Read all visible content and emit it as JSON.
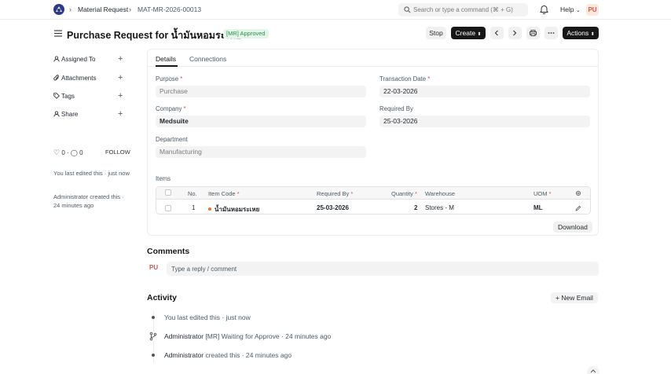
{
  "navbar": {
    "breadcrumbs": [
      "Material Request",
      "MAT-MR-2026-00013"
    ],
    "search_placeholder": "Search or type a command (⌘ + G)",
    "help_label": "Help",
    "user_initials": "PU"
  },
  "page": {
    "title": "Purchase Request for น้ำมันหอมระเหย",
    "status": "[MR] Approved",
    "buttons": {
      "stop": "Stop",
      "create": "Create",
      "actions": "Actions"
    }
  },
  "sidebar": {
    "items": [
      {
        "label": "Assigned To",
        "icon": "user-icon"
      },
      {
        "label": "Attachments",
        "icon": "paperclip-icon"
      },
      {
        "label": "Tags",
        "icon": "tag-icon"
      },
      {
        "label": "Share",
        "icon": "share-icon"
      }
    ],
    "likes": "0",
    "comments": "0",
    "follow_label": "FOLLOW",
    "last_edited": "You last edited this · just now",
    "created": "Administrator created this · 24 minutes ago"
  },
  "tabs": [
    "Details",
    "Connections"
  ],
  "form": {
    "purpose": {
      "label": "Purpose",
      "value": "Purchase"
    },
    "transaction_date": {
      "label": "Transaction Date",
      "value": "22-03-2026"
    },
    "company": {
      "label": "Company",
      "value": "Medsuite"
    },
    "required_by": {
      "label": "Required By",
      "value": "25-03-2026"
    },
    "department": {
      "label": "Department",
      "placeholder": "Manufacturing"
    }
  },
  "items": {
    "label": "Items",
    "columns": [
      "No.",
      "Item Code",
      "Required By",
      "Quantity",
      "Warehouse",
      "UOM"
    ],
    "rows": [
      {
        "no": "1",
        "item_code": "น้ำมันหอมระเหย",
        "required_by": "25-03-2026",
        "quantity": "2",
        "warehouse": "Stores - M",
        "uom": "ML"
      }
    ],
    "download_label": "Download"
  },
  "comments": {
    "title": "Comments",
    "avatar": "PU",
    "placeholder": "Type a reply / comment"
  },
  "activity": {
    "title": "Activity",
    "new_email_label": "+ New Email",
    "entries": [
      {
        "actor": "",
        "text": "You last edited this · just now"
      },
      {
        "actor": "Administrator",
        "text": " [MR] Waiting for Approve · 24 minutes ago"
      },
      {
        "actor": "Administrator",
        "text": " created this · 24 minutes ago"
      }
    ]
  }
}
